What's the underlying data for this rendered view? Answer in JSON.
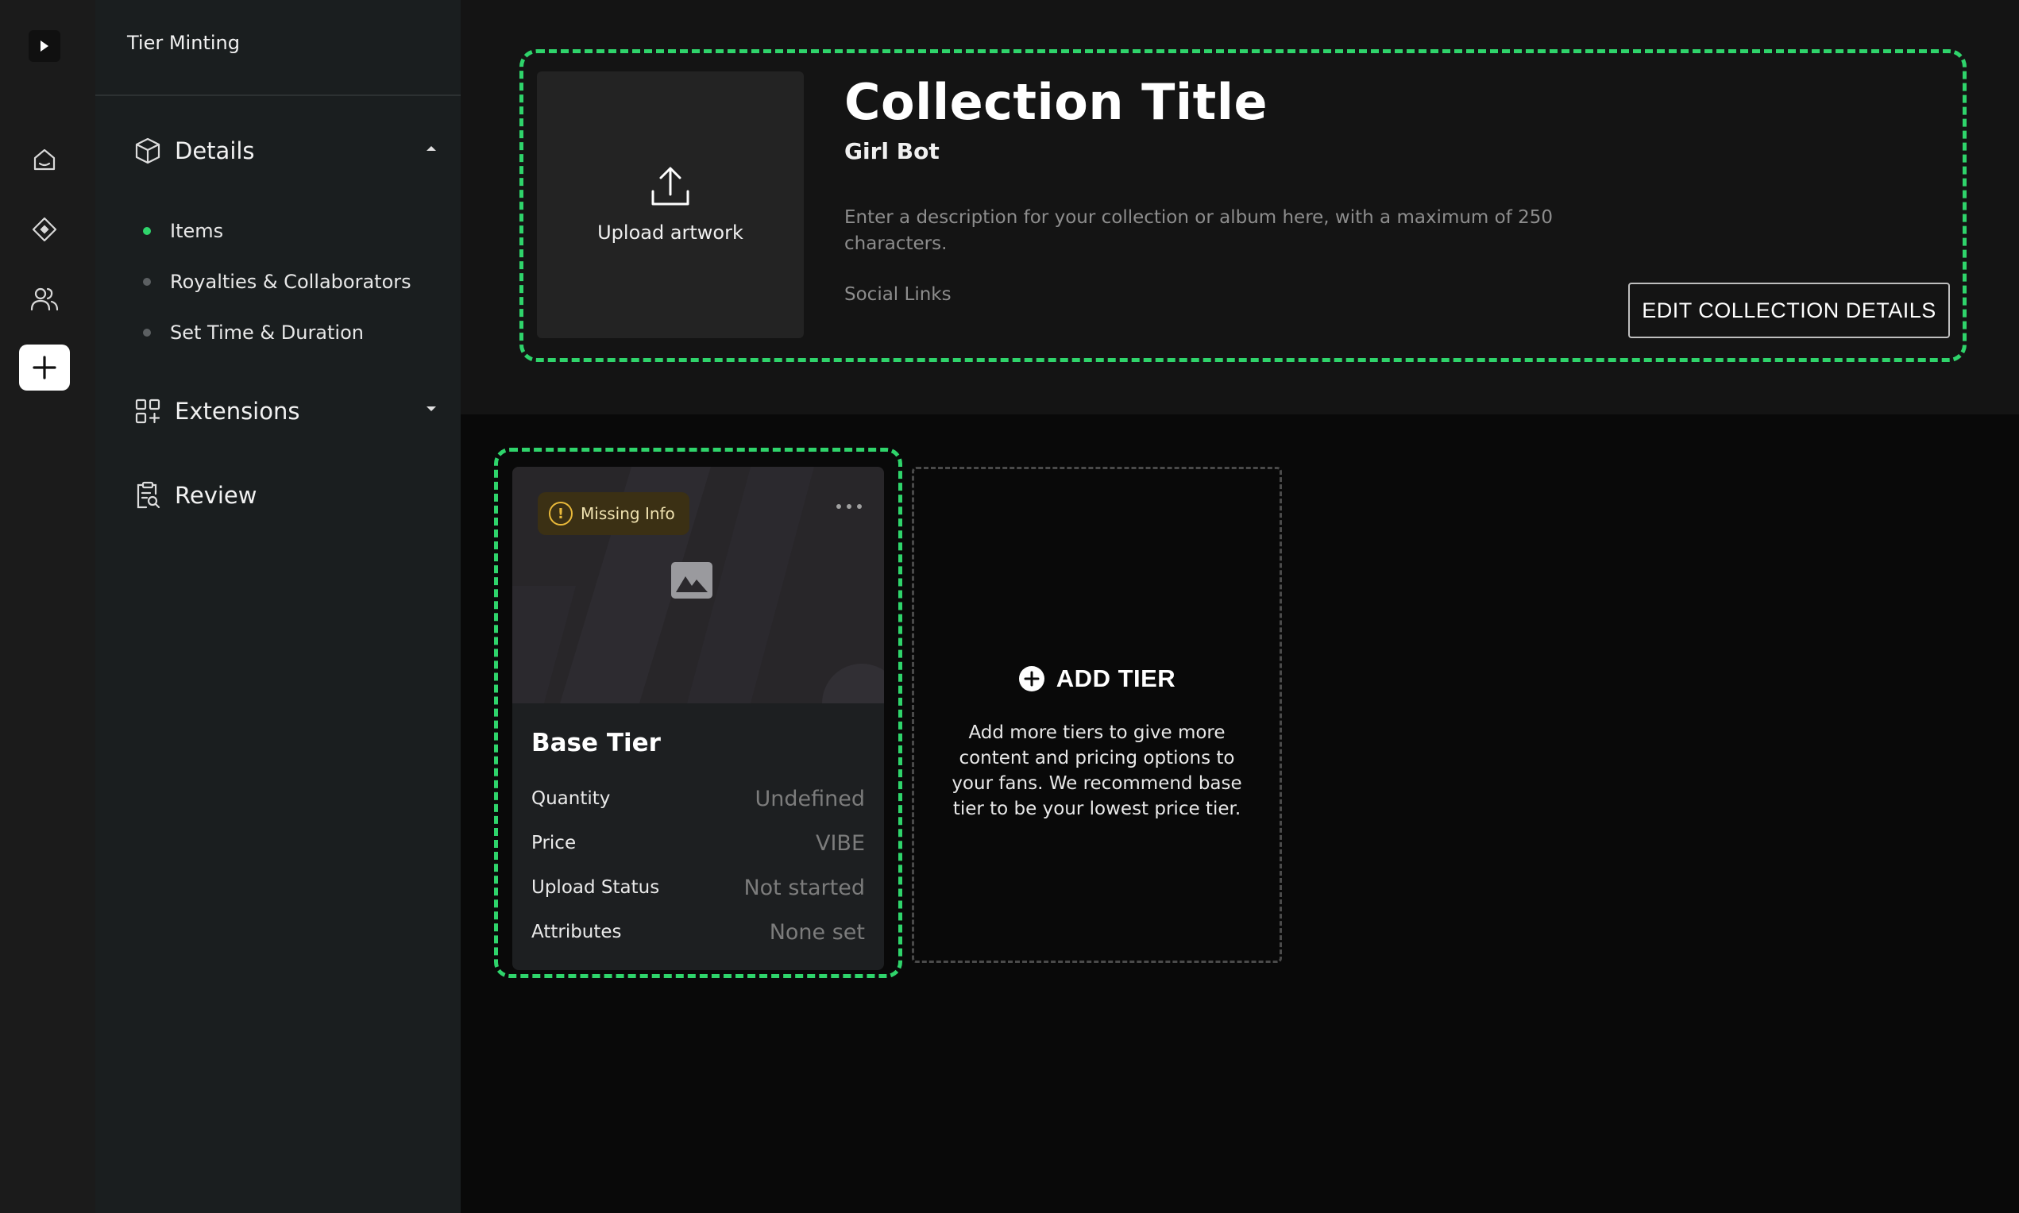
{
  "sidebar": {
    "title": "Tier Minting",
    "sections": [
      {
        "label": "Details"
      },
      {
        "label": "Extensions"
      },
      {
        "label": "Review"
      }
    ],
    "details_items": [
      {
        "label": "Items",
        "active": true
      },
      {
        "label": "Royalties & Collaborators",
        "active": false
      },
      {
        "label": "Set Time & Duration",
        "active": false
      }
    ]
  },
  "rail": {
    "icons": [
      "home-icon",
      "diamond-icon",
      "users-icon",
      "plus-icon"
    ]
  },
  "collection": {
    "upload_label": "Upload artwork",
    "title": "Collection Title",
    "subtitle": "Girl Bot",
    "description": "Enter a description for your collection or album here, with a maximum of 250 characters.",
    "social_links": "Social Links",
    "edit_button": "EDIT COLLECTION DETAILS"
  },
  "tier": {
    "badge": "Missing Info",
    "name": "Base Tier",
    "rows": [
      {
        "label": "Quantity",
        "value": "Undefined"
      },
      {
        "label": "Price",
        "value": "VIBE"
      },
      {
        "label": "Upload Status",
        "value": "Not started"
      },
      {
        "label": "Attributes",
        "value": "None set"
      }
    ]
  },
  "add_tier": {
    "title": "ADD TIER",
    "description": "Add more tiers to give more content and pricing options to your fans. We recommend base tier to be your lowest price tier."
  },
  "colors": {
    "accent": "#2fd46b",
    "warning": "#e9b93a"
  }
}
